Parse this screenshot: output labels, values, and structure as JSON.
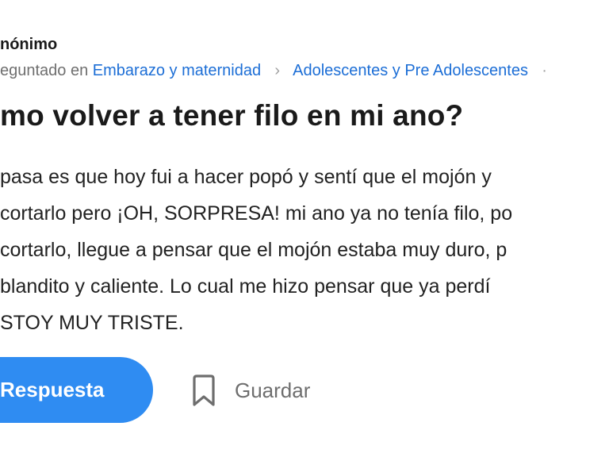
{
  "question": {
    "author": "nónimo",
    "meta": {
      "asked_label": "eguntado en",
      "categories": [
        "Embarazo y maternidad",
        "Adolescentes y Pre Adolescentes"
      ],
      "separator": "›",
      "trailing": "·"
    },
    "title": "mo volver a tener filo en mi ano?",
    "body_lines": [
      "pasa es que hoy fui a hacer popó y sentí que el mojón y",
      "cortarlo pero ¡OH, SORPRESA! mi ano ya no tenía filo, po",
      "cortarlo, llegue a pensar que el mojón estaba muy duro, p",
      "blandito y caliente. Lo cual me hizo pensar que ya perdí",
      "STOY MUY TRISTE."
    ]
  },
  "actions": {
    "answer_label": "Respuesta",
    "save_label": "Guardar"
  },
  "colors": {
    "link": "#1c6ed6",
    "primary_button": "#2f8cf2",
    "text": "#1a1a1a",
    "muted": "#6f6f6f"
  },
  "icons": {
    "save": "bookmark-icon",
    "breadcrumb_separator": "chevron-right-icon"
  }
}
